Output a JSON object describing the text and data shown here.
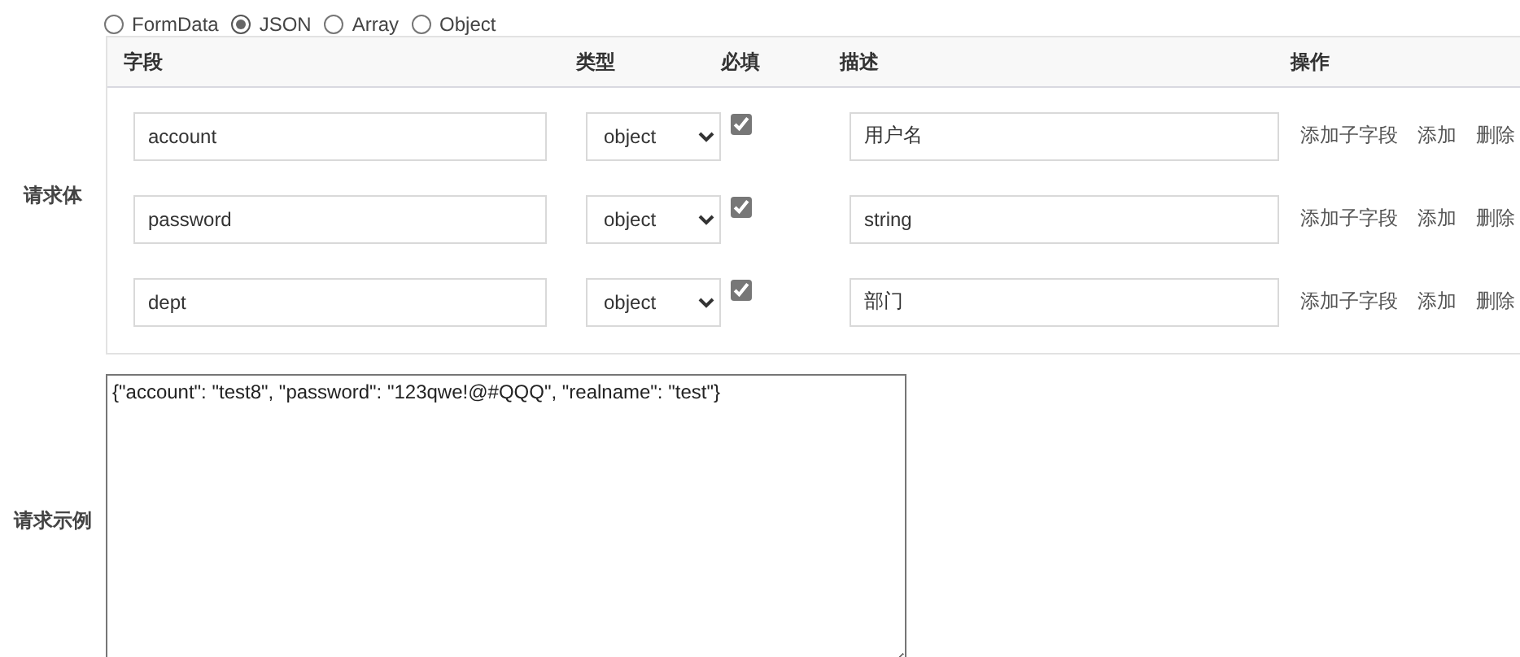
{
  "body_types": [
    {
      "label": "FormData",
      "selected": false
    },
    {
      "label": "JSON",
      "selected": true
    },
    {
      "label": "Array",
      "selected": false
    },
    {
      "label": "Object",
      "selected": false
    }
  ],
  "request_body": {
    "label": "请求体",
    "columns": [
      "字段",
      "类型",
      "必填",
      "描述",
      "操作"
    ],
    "rows": [
      {
        "field": "account",
        "type": "object",
        "required": true,
        "description": "用户名",
        "actions": [
          "添加子字段",
          "添加",
          "删除"
        ]
      },
      {
        "field": "password",
        "type": "object",
        "required": true,
        "description": "string",
        "actions": [
          "添加子字段",
          "添加",
          "删除"
        ]
      },
      {
        "field": "dept",
        "type": "object",
        "required": true,
        "description": "部门",
        "actions": [
          "添加子字段",
          "添加",
          "删除"
        ]
      }
    ]
  },
  "request_example": {
    "label": "请求示例",
    "value": "{\"account\": \"test8\", \"password\": \"123qwe!@#QQQ\", \"realname\": \"test\"}"
  }
}
